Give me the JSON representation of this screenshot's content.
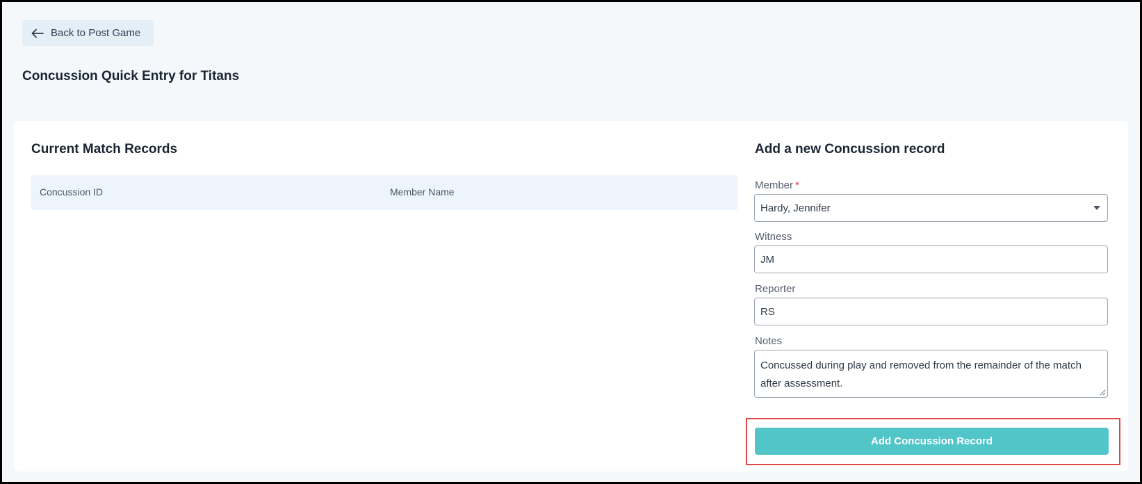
{
  "header": {
    "back_label": "Back to Post Game",
    "page_title": "Concussion Quick Entry for Titans"
  },
  "records": {
    "title": "Current Match Records",
    "columns": [
      "Concussion ID",
      "Member Name"
    ],
    "rows": []
  },
  "form": {
    "title": "Add a new Concussion record",
    "member_label": "Member",
    "member_required_marker": "*",
    "member_value": "Hardy, Jennifer",
    "witness_label": "Witness",
    "witness_value": "JM",
    "reporter_label": "Reporter",
    "reporter_value": "RS",
    "notes_label": "Notes",
    "notes_value": "Concussed during play and removed from the remainder of the match after assessment.",
    "submit_label": "Add Concussion Record"
  },
  "colors": {
    "accent": "#52c5c8",
    "highlight": "#e04848",
    "required": "#dc3545"
  },
  "icons": {
    "back": "arrow-left-icon",
    "member_dropdown": "caret-down-icon"
  }
}
